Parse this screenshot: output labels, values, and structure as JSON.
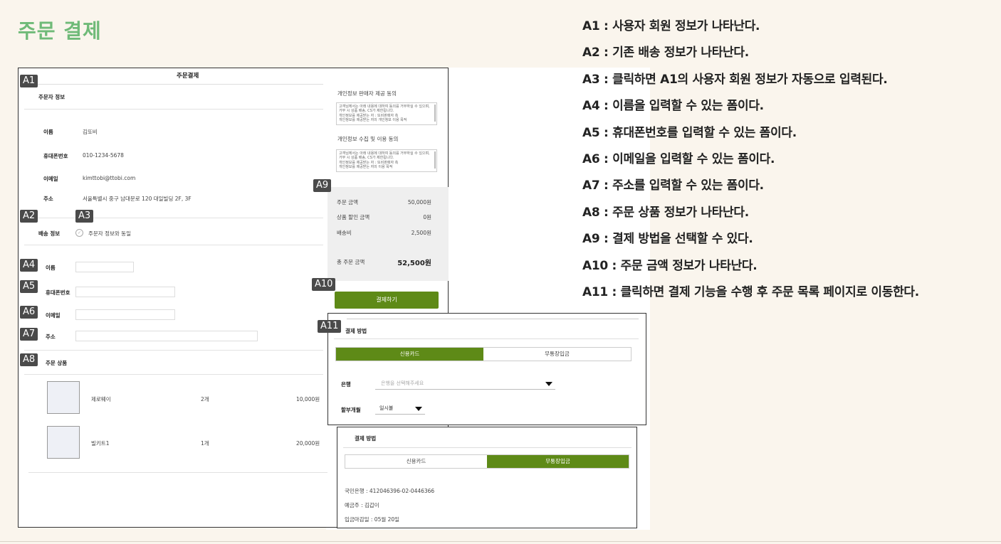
{
  "page_title": "주문 결제",
  "tags": [
    "A1",
    "A2",
    "A3",
    "A4",
    "A5",
    "A6",
    "A7",
    "A8",
    "A9",
    "A10",
    "A11"
  ],
  "mockup": {
    "title": "주문결제",
    "orderer_section": "주문자 정보",
    "orderer_rows": [
      {
        "label": "이름",
        "value": "김또비"
      },
      {
        "label": "휴대폰번호",
        "value": "010-1234-5678"
      },
      {
        "label": "이메일",
        "value": "kimttobi@ttobi.com"
      },
      {
        "label": "주소",
        "value": "서울특별시 중구 남대문로 120 대일빌딩 2F, 3F"
      }
    ],
    "shipping_section": "배송 정보",
    "same_as_orderer": "주문자 정보와 동일",
    "form_labels": [
      "이름",
      "휴대폰번호",
      "이메일",
      "주소"
    ],
    "products_section": "주문 상품",
    "products": [
      {
        "name": "제로웨이",
        "qty": "2개",
        "price": "10,000원"
      },
      {
        "name": "빌키트1",
        "qty": "1개",
        "price": "20,000원"
      }
    ],
    "consent1_title": "개인정보 판매자 제공 동의",
    "consent1_text": [
      "고객님께서는 아래 내용에 대하여 동의를 거부하실 수 있으며,",
      "거부 시 상품 배송, CS가 제한됩니다.",
      "개인정보를 제공받는 자 : 또비판매자 측",
      "개인정보를 제공받는 자의 개인정보 이용 목적"
    ],
    "consent2_title": "개인정보 수집 및 이용 동의",
    "consent2_text": [
      "고객님께서는 아래 내용에 대하여 동의를 거부하실 수 있으며,",
      "거부 시 상품 배송, CS가 제한됩니다.",
      "개인정보를 제공받는 자 : 또비판매자 측",
      "개인정보를 제공받는 자의 이용 목적"
    ],
    "summary": [
      {
        "label": "주문 금액",
        "value": "50,000원"
      },
      {
        "label": "상품 할인 금액",
        "value": "0원"
      },
      {
        "label": "배송비",
        "value": "2,500원"
      }
    ],
    "total_label": "총 주문 금액",
    "total_value": "52,500원",
    "pay_button": "결제하기"
  },
  "popup_card": {
    "title": "결제 방법",
    "tab_card": "신용카드",
    "tab_bank": "무통장입금",
    "bank_label": "은행",
    "bank_placeholder": "은행을 선택해주세요",
    "installment_label": "할부개월",
    "installment_value": "일시불"
  },
  "popup_bank": {
    "title": "결제 방법",
    "tab_card": "신용카드",
    "tab_bank": "무통장입금",
    "account": "국민은행 : 412046396-02-0446366",
    "holder": "예금주 : 김갑이",
    "deadline": "입금마감일 :  05월 20일"
  },
  "descriptions": [
    "A1 : 사용자 회원 정보가 나타난다.",
    "A2 : 기존 배송 정보가 나타난다.",
    "A3 : 클릭하면 A1의 사용자 회원 정보가 자동으로 입력된다.",
    "A4 : 이름을 입력할 수 있는 폼이다.",
    "A5 : 휴대폰번호를 입력할 수 있는 폼이다.",
    "A6 : 이메일을 입력할 수 있는 폼이다.",
    "A7 : 주소를 입력할 수 있는 폼이다.",
    "A8 : 주문 상품 정보가 나타난다.",
    "A9 : 결제 방법을 선택할 수 있다.",
    "A10 : 주문 금액 정보가 나타난다.",
    "A11 : 클릭하면 결제 기능을 수행 후 주문 목록 페이지로 이동한다."
  ],
  "colors": {
    "title_green": "#6fba78",
    "button_green": "#5e8a17",
    "tag_bg": "#4a4a4a",
    "page_bg": "#faf5ed"
  }
}
